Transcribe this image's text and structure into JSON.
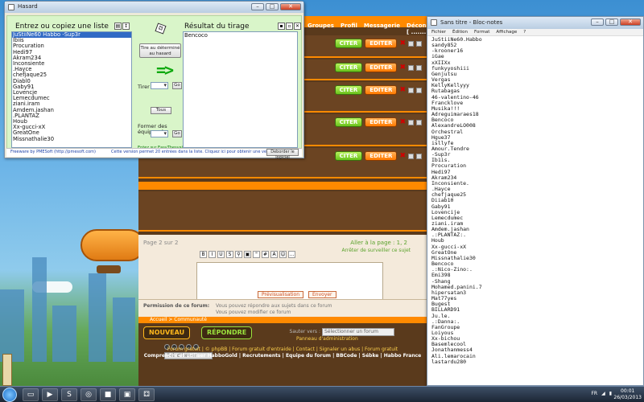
{
  "hasard": {
    "title": "Hasard",
    "left_heading": "Entrez ou copiez une liste",
    "right_heading": "Résultat du tirage",
    "draw_button": "Tire au déterminé au hasard",
    "arrow_symbol": "=>",
    "tirer_label": "Tirer",
    "go_label": "Go",
    "tous_label": "Tous",
    "teams_label": "Former des équipes de",
    "link_text": "Entez sur EasyThesyai.com",
    "status_left": "Freeware by PMESoft (http://pmesoft.com)",
    "status_mid": "Cette version permet 20 entrées dans la liste. Cliquez ici pour obtenir une version débridée",
    "status_button": "Deborder le logiciel",
    "list_items": [
      "JuStiiNe60 Habbo -Sup3r",
      "Ibiis",
      "Procuration",
      "Hedi97",
      "Akram234",
      "Inconsiente",
      ".Hayce",
      "chefjaque25",
      "Diabl0",
      "Gaby91",
      "Lovencje",
      "Lemecdumec",
      "ziani.iram",
      "Amdem.jashan",
      ".PLANTAZ",
      "Houb",
      "Xx-gucci-xX",
      "GreatOne",
      "Missnathalie30"
    ],
    "selected_index": 0,
    "result_items": [
      "Bencoco"
    ]
  },
  "forum": {
    "nav_links": [
      "Groupes",
      "Profil",
      "Messagerie",
      "Déconnexion [ ....... ]"
    ],
    "cite_label": "CITER",
    "edit_label": "EDITER",
    "page_info": "Page 2 sur 2",
    "goto_page": "Aller à la page : 1, 2",
    "follow_up": "Arrêter de surveiller ce sujet",
    "preview_button": "Prévisualisation",
    "send_button": "Envoyer",
    "permissions_label": "Permission de ce forum:",
    "permissions_lines": [
      "Vous pouvez répondre aux sujets dans ce forum",
      "Vous pouvez modifier ce forum"
    ],
    "orange_link": "Accueil > Communauté",
    "new_topic_badge": "NOUVEAU",
    "reply_badge": "RÉPONDRE",
    "jump_label": "Sauter vers :",
    "jump_placeholder": "Sélectionner un forum",
    "small_select": "Sélectionner",
    "admin_link": "Panneau d'administration",
    "footer_lines": [
      "Forum gratuit | © phpBB | Forum gratuit d'entraide | Contact | Signaler un abus | Forum gratuit",
      "Comprendre et utiliser HabboGold | Recrutements | Equipe du forum | BBCode | Sébke | Habbo France"
    ]
  },
  "notepad": {
    "title": "Sans titre - Bloc-notes",
    "menu": [
      "Fichier",
      "Édition",
      "Format",
      "Affichage",
      "?"
    ],
    "lines": [
      "JuStiiNe60.Habbo",
      "sandy852",
      "-krooner16",
      "iGae",
      "xXIIXx",
      "funkyyoshiii",
      "Genjutsu",
      "Vergas",
      "KellyKellyyy",
      "Rutabagas",
      "46-valentino-46",
      "Francklove",
      "Musika!!!",
      "Adreguimaraes18",
      "Bencoco",
      "AlexandreLO008",
      "Orchestral",
      "Hgue37",
      "isllyfe",
      "Amour.Tendre",
      "-Sup3r",
      "Ib1is.",
      "Procuration",
      "Hedi97",
      "Akram234",
      "Inconsiente.",
      ".Hayce",
      "chefjaque25",
      "Diiab10",
      "Gaby91",
      "Lovencije",
      "Lemecdumec",
      "ziani.iram",
      "Amdem.jashan",
      ".:PLANTAZ:.",
      "Houb",
      "Xx-gucci-xX",
      "GreatOne",
      "Missnathalie30",
      "Bencoco",
      ".:Nico-Zino:.",
      "Emi398",
      "-Shang",
      "Mohamed.panini.7",
      "hipersatan3",
      "Mat77yes",
      "Bugest",
      "BILLARD91",
      "Ju.le.",
      ".:Danna:.",
      "FanGroupe",
      "Loiyous",
      "Xx-bichou",
      "Basemlecool",
      "Jonathanmess4",
      "Ali.lemarocain",
      "lastardu280"
    ]
  },
  "taskbar": {
    "lang": "FR",
    "time": "00:01",
    "date": "26/03/2013",
    "icons": [
      "folder-icon",
      "media-icon",
      "skype-icon",
      "chrome-icon",
      "app-icon",
      "window-icon",
      "dice-app-icon"
    ]
  },
  "colors": {
    "forum_orange": "#ff8a00",
    "hasard_green": "#d9f5c9",
    "arrow_green": "#0fa90f"
  }
}
